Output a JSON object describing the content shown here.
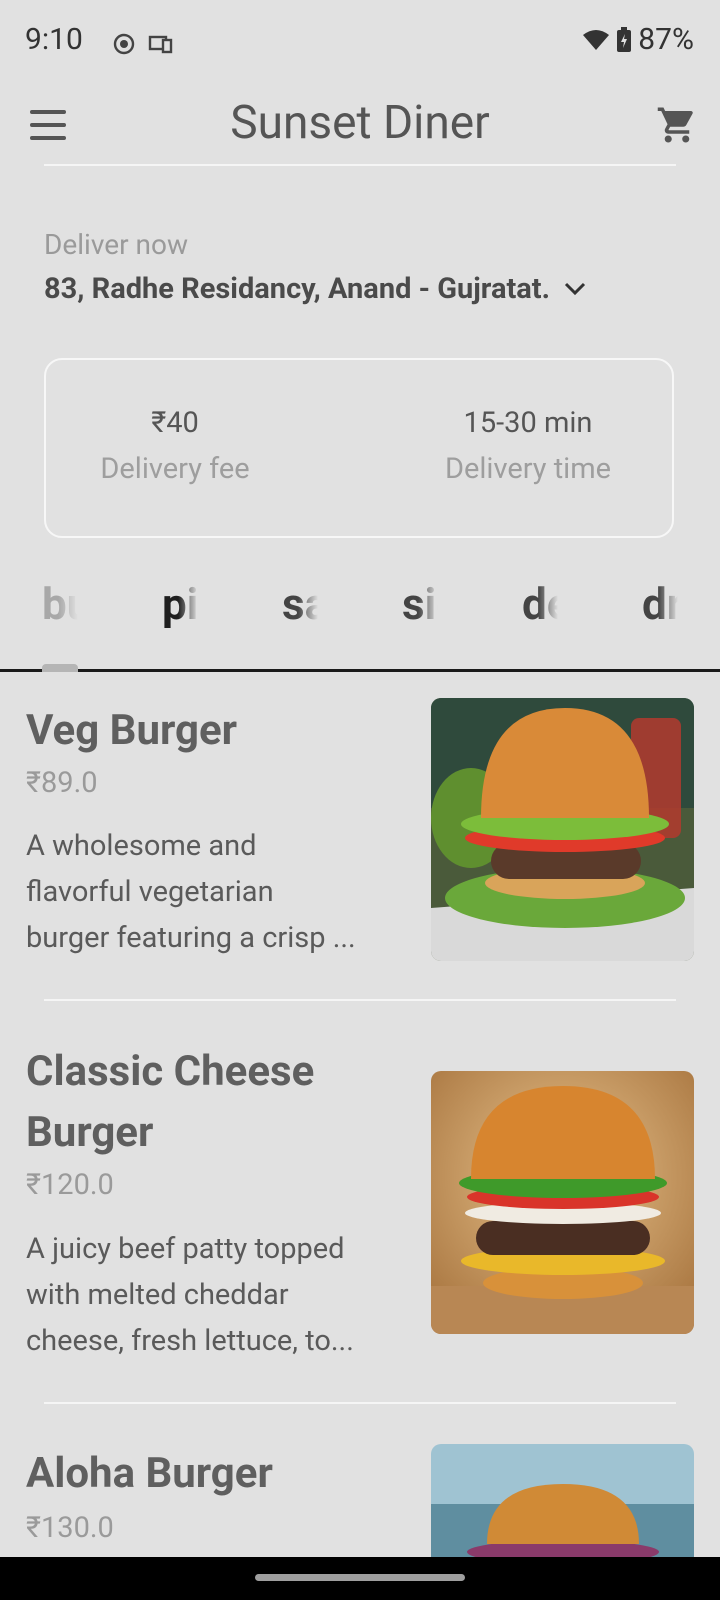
{
  "status": {
    "time": "9:10",
    "battery": "87%"
  },
  "header": {
    "title": "Sunset Diner"
  },
  "delivery": {
    "label": "Deliver now",
    "address": "83, Radhe Residancy, Anand - Gujratat.",
    "fee_value": "₹40",
    "fee_label": "Delivery fee",
    "time_value": "15-30 min",
    "time_label": "Delivery time"
  },
  "tabs": [
    {
      "label": "burgers"
    },
    {
      "label": "pizza"
    },
    {
      "label": "sandwiches"
    },
    {
      "label": "sides"
    },
    {
      "label": "desserts"
    },
    {
      "label": "drinks"
    }
  ],
  "active_tab": "burgers",
  "items": [
    {
      "name": "Veg Burger",
      "price": "₹89.0",
      "desc_lines": [
        "A wholesome and",
        "flavorful vegetarian",
        "burger featuring a crisp ..."
      ]
    },
    {
      "name_lines": [
        "Classic Cheese",
        "Burger"
      ],
      "price": "₹120.0",
      "desc_lines": [
        "A juicy beef patty topped",
        "with melted cheddar",
        "cheese, fresh lettuce, to..."
      ]
    },
    {
      "name": "Aloha Burger",
      "price": "₹130.0"
    }
  ],
  "colors": {
    "background": "#e1e1e1",
    "accent_line": "#1a1a1a"
  }
}
